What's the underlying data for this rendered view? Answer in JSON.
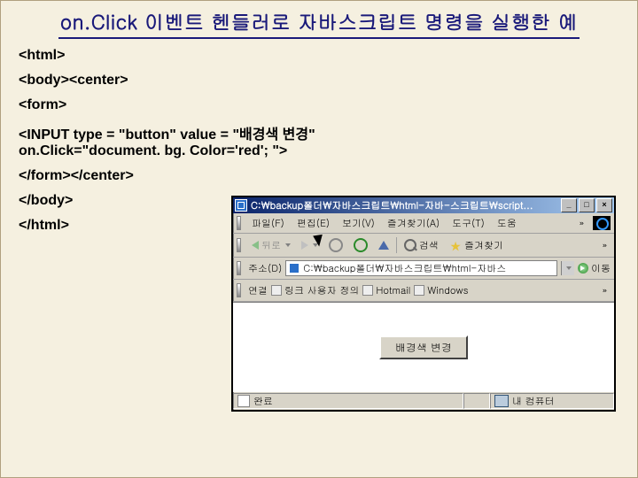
{
  "title": "on.Click 이벤트 헨들러로 자바스크립트 명령을 실행한 예",
  "code": {
    "l1": "<html>",
    "l2": "<body><center>",
    "l3": "<form>",
    "l4a": "<INPUT type = \"button\" value = \"배경색 변경\"",
    "l4b": "on.Click=\"document. bg. Color='red'; \">",
    "l5": "</form></center>",
    "l6": "</body>",
    "l7": "</html>"
  },
  "ie": {
    "title": "C:\\backup폴더\\자바스크립트\\html-자바-스크립트\\script...",
    "menu": {
      "file": "파일(F)",
      "edit": "편집(E)",
      "view": "보기(V)",
      "fav": "즐겨찾기(A)",
      "tools": "도구(T)",
      "help": "도움",
      "more": "»"
    },
    "toolbar": {
      "back": "뒤로",
      "search": "검색",
      "favorites": "즐겨찾기",
      "more": "»"
    },
    "address": {
      "label": "주소(D)",
      "value": "C:\\backup폴더\\자바스크립트\\html-자바스",
      "go": "이동"
    },
    "links": {
      "label": "연결",
      "custom": "링크 사용자 정의",
      "hotmail": "Hotmail",
      "windows": "Windows",
      "more": "»"
    },
    "button_label": "배경색 변경",
    "status": {
      "done": "완료",
      "zone": "내 컴퓨터"
    }
  }
}
